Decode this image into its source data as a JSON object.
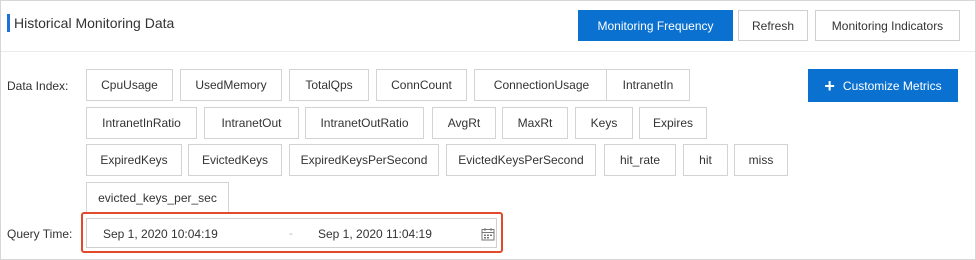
{
  "header": {
    "title": "Historical Monitoring Data"
  },
  "toolbar": {
    "monitoring_frequency": "Monitoring Frequency",
    "refresh": "Refresh",
    "monitoring_indicators": "Monitoring Indicators"
  },
  "data_index": {
    "label": "Data Index:",
    "metrics": [
      "CpuUsage",
      "UsedMemory",
      "TotalQps",
      "ConnCount",
      "ConnectionUsage",
      "IntranetIn",
      "IntranetInRatio",
      "IntranetOut",
      "IntranetOutRatio",
      "AvgRt",
      "MaxRt",
      "Keys",
      "Expires",
      "ExpiredKeys",
      "EvictedKeys",
      "ExpiredKeysPerSecond",
      "EvictedKeysPerSecond",
      "hit_rate",
      "hit",
      "miss",
      "evicted_keys_per_sec"
    ],
    "customize_button": "Customize Metrics",
    "customize_icon": "plus-icon"
  },
  "query_time": {
    "label": "Query Time:",
    "start": "Sep 1, 2020 10:04:19",
    "separator": "-",
    "end": "Sep 1, 2020 11:04:19",
    "icon": "calendar-icon"
  },
  "colors": {
    "primary": "#0a71d1",
    "highlight": "#e24a2c",
    "accent_bar": "#1a73d9"
  }
}
